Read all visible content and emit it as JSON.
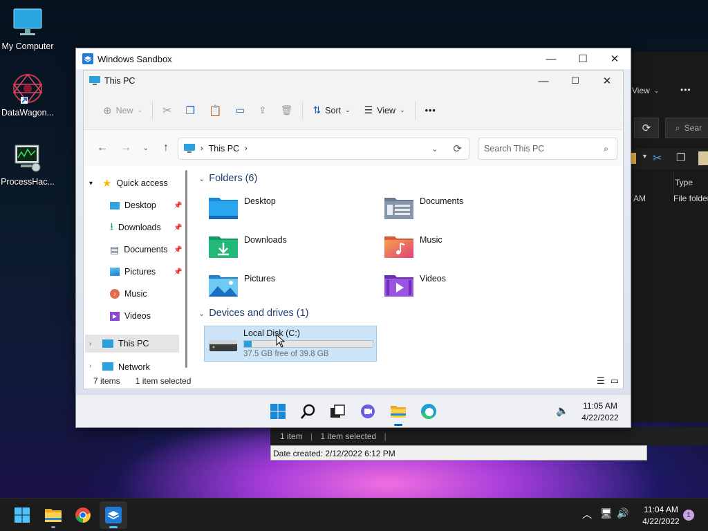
{
  "desktop": {
    "icons": [
      {
        "label": "My Computer"
      },
      {
        "label": "DataWagon..."
      },
      {
        "label": "ProcessHac..."
      }
    ]
  },
  "background_explorer": {
    "view_label": "View",
    "more": "•••",
    "search_placeholder": "Sear",
    "col_type": "Type",
    "row_time": "AM",
    "row_type": "File folder",
    "status_items": "1 item",
    "status_selected": "1 item selected",
    "tooltip": "Date created: 2/12/2022 6:12 PM"
  },
  "sandbox": {
    "title": "Windows Sandbox",
    "explorer": {
      "title": "This PC",
      "toolbar": {
        "new_label": "New",
        "sort_label": "Sort",
        "view_label": "View",
        "more": "•••"
      },
      "address": {
        "location": "This PC"
      },
      "search": {
        "placeholder": "Search This PC"
      },
      "nav": {
        "quick_access": "Quick access",
        "items": [
          {
            "label": "Desktop",
            "pinned": true
          },
          {
            "label": "Downloads",
            "pinned": true
          },
          {
            "label": "Documents",
            "pinned": true
          },
          {
            "label": "Pictures",
            "pinned": true
          },
          {
            "label": "Music",
            "pinned": false
          },
          {
            "label": "Videos",
            "pinned": false
          }
        ],
        "this_pc": "This PC",
        "network": "Network"
      },
      "folders_header": "Folders (6)",
      "folders": [
        {
          "label": "Desktop"
        },
        {
          "label": "Documents"
        },
        {
          "label": "Downloads"
        },
        {
          "label": "Music"
        },
        {
          "label": "Pictures"
        },
        {
          "label": "Videos"
        }
      ],
      "devices_header": "Devices and drives (1)",
      "drive": {
        "label": "Local Disk (C:)",
        "free_text": "37.5 GB free of 39.8 GB",
        "used_fraction": 0.058
      },
      "status": {
        "items": "7 items",
        "selected": "1 item selected"
      }
    },
    "taskbar": {
      "time": "11:05 AM",
      "date": "4/22/2022"
    }
  },
  "taskbar": {
    "time": "11:04 AM",
    "date": "4/22/2022",
    "notification_count": "1"
  },
  "colors": {
    "accent": "#0067c0",
    "selected": "#cce4f7",
    "drive_bar": "#26a0da"
  }
}
